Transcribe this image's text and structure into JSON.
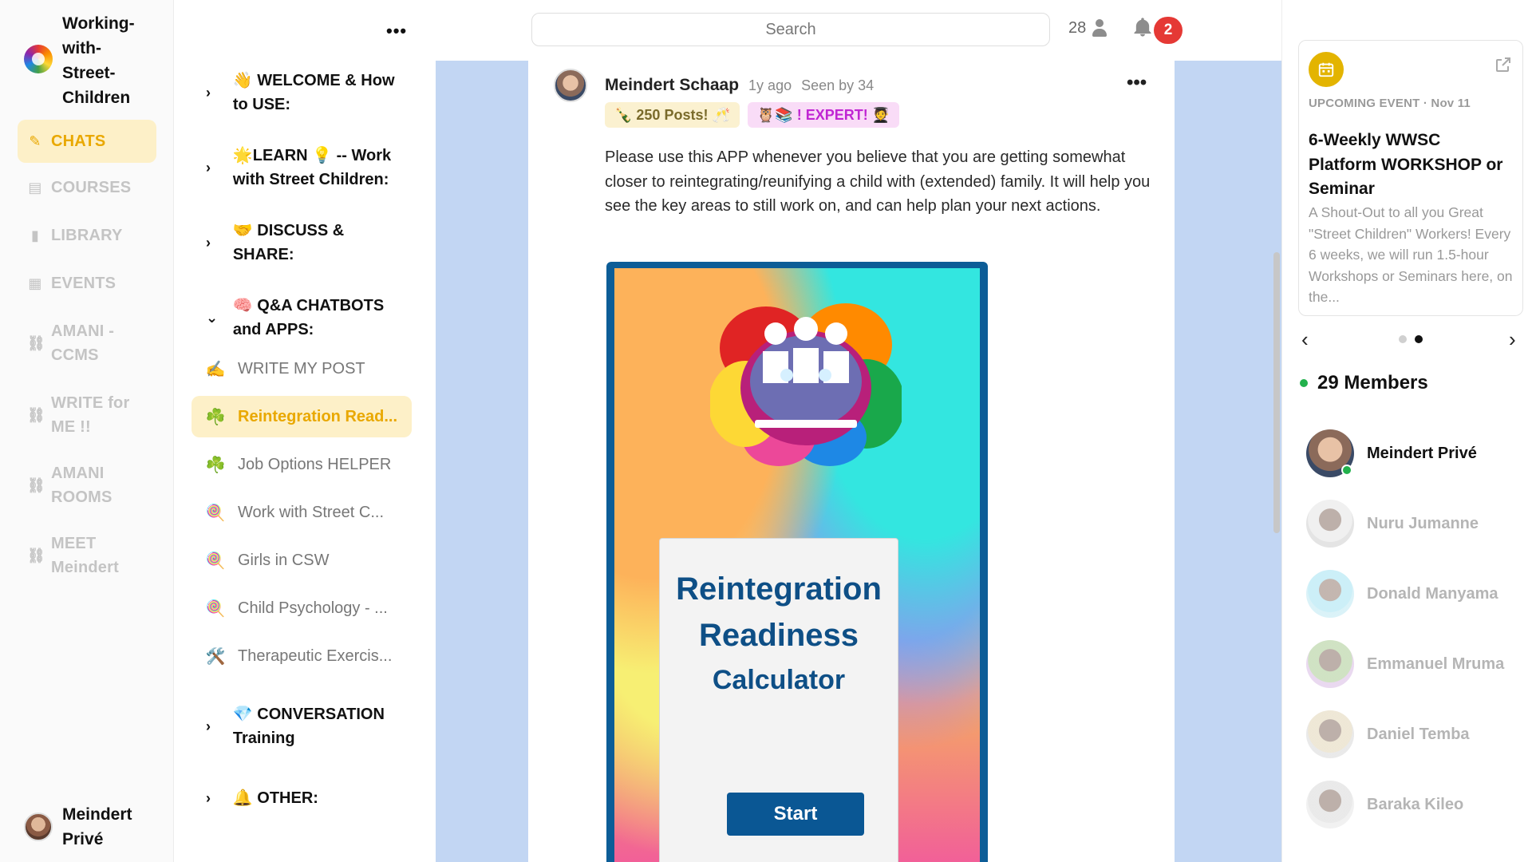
{
  "app": {
    "name": "Working-with-Street-Children"
  },
  "leftnav": {
    "items": [
      {
        "label": "CHATS",
        "icon": "pencil-icon",
        "active": true
      },
      {
        "label": "COURSES",
        "icon": "book-icon"
      },
      {
        "label": "LIBRARY",
        "icon": "document-icon"
      },
      {
        "label": "EVENTS",
        "icon": "calendar-icon"
      },
      {
        "label": "AMANI - CCMS",
        "icon": "link-icon"
      },
      {
        "label": "WRITE for ME !!",
        "icon": "link-icon"
      },
      {
        "label": "AMANI ROOMS",
        "icon": "link-icon"
      },
      {
        "label": "MEET Meindert",
        "icon": "link-icon"
      }
    ],
    "user": {
      "name": "Meindert Privé"
    }
  },
  "channels": {
    "groups": [
      {
        "label": "👋 WELCOME & How to USE:",
        "chevron": "›"
      },
      {
        "label": "🌟LEARN 💡 -- Work with Street Children:",
        "chevron": "›"
      },
      {
        "label": "🤝 DISCUSS & SHARE:",
        "chevron": "›"
      },
      {
        "label": "🧠 Q&A CHATBOTS and APPS:",
        "chevron": "⌄"
      }
    ],
    "items": [
      {
        "icon": "✍️",
        "label": "WRITE MY POST"
      },
      {
        "icon": "☘️",
        "label": "Reintegration Read...",
        "active": true
      },
      {
        "icon": "☘️",
        "label": "Job Options HELPER"
      },
      {
        "icon": "🍭",
        "label": "Work with Street C..."
      },
      {
        "icon": "🍭",
        "label": "Girls in CSW"
      },
      {
        "icon": "🍭",
        "label": "Child Psychology - ..."
      },
      {
        "icon": "🛠️",
        "label": "Therapeutic Exercis..."
      }
    ],
    "groups_bottom": [
      {
        "label": "💎 CONVERSATION Training",
        "chevron": "›"
      },
      {
        "label": "🔔 OTHER:",
        "chevron": "›"
      }
    ]
  },
  "topbar": {
    "search_placeholder": "Search",
    "online_count": "28",
    "notification_count": "2"
  },
  "post": {
    "author": "Meindert Schaap",
    "time": "1y ago",
    "seen": "Seen by 34",
    "tags": [
      {
        "label": "🍾 250 Posts! 🥂",
        "style": "green"
      },
      {
        "label": "🦉📚 ! EXPERT! 🧑‍🎓",
        "style": "purple"
      }
    ],
    "body": "Please use this APP whenever you believe that you are getting somewhat closer to reintegrating/reunifying a child with (extended) family. It will help you see the key areas to still work on, and can help plan your next actions.",
    "app_card": {
      "title_line1": "Reintegration",
      "title_line2": "Readiness",
      "title_line3": "Calculator",
      "button": "Start"
    }
  },
  "event": {
    "label": "UPCOMING EVENT · Nov 11",
    "title": "6-Weekly WWSC Platform WORKSHOP or Seminar",
    "description": "A Shout-Out to all you Great \"Street Children\" Workers! Every 6 weeks, we will run 1.5-hour Workshops or Seminars here, on the...",
    "carousel": {
      "prev": "‹",
      "next": "›",
      "active_dot": 1,
      "dots": 2
    }
  },
  "members": {
    "heading": "29 Members",
    "list": [
      {
        "name": "Meindert Privé",
        "online": true
      },
      {
        "name": "Nuru Jumanne"
      },
      {
        "name": "Donald Manyama"
      },
      {
        "name": "Emmanuel Mruma"
      },
      {
        "name": "Daniel Temba"
      },
      {
        "name": "Baraka Kileo"
      }
    ]
  },
  "colors": {
    "accent": "#e9a800",
    "accent_bg": "#fdf0c8",
    "brand_blue": "#0e4f86",
    "badge_red": "#e53935",
    "online_green": "#22b14c",
    "feed_bg": "#c2d6f3"
  }
}
